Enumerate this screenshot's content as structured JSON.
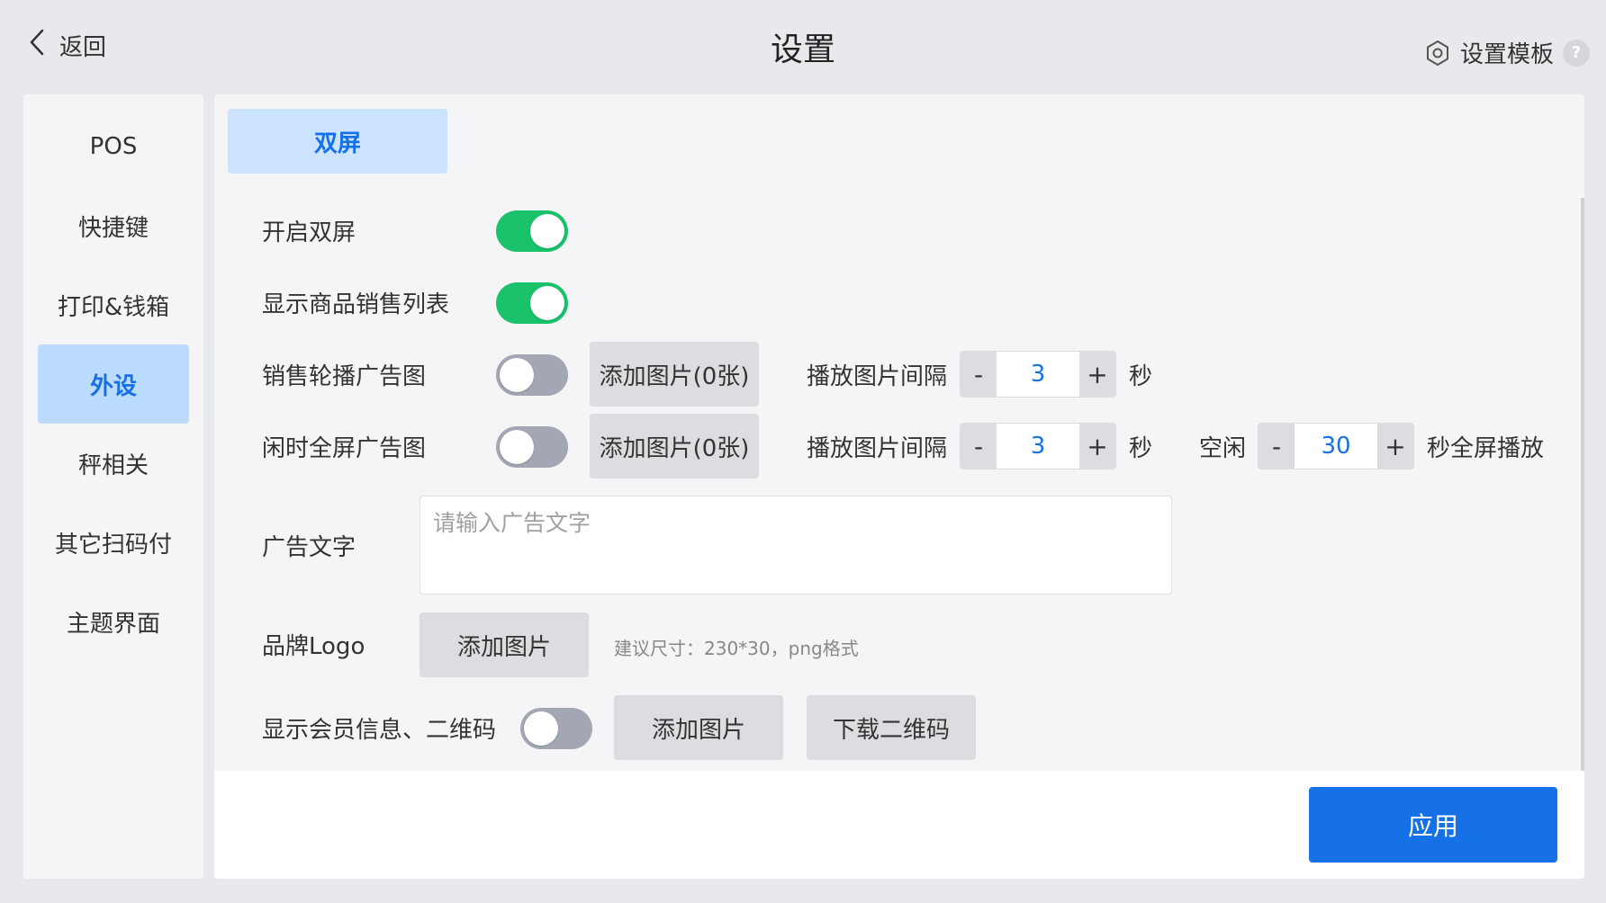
{
  "header": {
    "back_label": "返回",
    "title": "设置",
    "template_label": "设置模板",
    "help_glyph": "?"
  },
  "sidebar": {
    "items": [
      {
        "label": "POS",
        "active": false
      },
      {
        "label": "快捷键",
        "active": false
      },
      {
        "label": "打印&钱箱",
        "active": false
      },
      {
        "label": "外设",
        "active": true
      },
      {
        "label": "秤相关",
        "active": false
      },
      {
        "label": "其它扫码付",
        "active": false
      },
      {
        "label": "主题界面",
        "active": false
      }
    ]
  },
  "main": {
    "tab_label": "双屏",
    "dual_screen": {
      "label": "开启双屏",
      "on": true
    },
    "sales_list": {
      "label": "显示商品销售列表",
      "on": true
    },
    "carousel_ad": {
      "label": "销售轮播广告图",
      "on": false,
      "add_button": "添加图片(0张)",
      "interval_label": "播放图片间隔",
      "interval_value": "3",
      "unit": "秒"
    },
    "idle_ad": {
      "label": "闲时全屏广告图",
      "on": false,
      "add_button": "添加图片(0张)",
      "interval_label": "播放图片间隔",
      "interval_value": "3",
      "unit": "秒",
      "idle_label": "空闲",
      "idle_value": "30",
      "idle_suffix": "秒全屏播放"
    },
    "ad_text": {
      "label": "广告文字",
      "value": "",
      "placeholder": "请输入广告文字"
    },
    "brand_logo": {
      "label": "品牌Logo",
      "add_button": "添加图片",
      "hint": "建议尺寸：230*30，png格式"
    },
    "member_info": {
      "label": "显示会员信息、二维码",
      "on": false,
      "add_button": "添加图片",
      "download_button": "下载二维码"
    },
    "stepper_minus": "-",
    "stepper_plus": "+"
  },
  "footer": {
    "apply_label": "应用"
  },
  "colors": {
    "accent": "#1670e6",
    "toggle_on": "#1ac26b",
    "toggle_off": "#a3a7b4",
    "tab_bg": "#cce4fd"
  }
}
